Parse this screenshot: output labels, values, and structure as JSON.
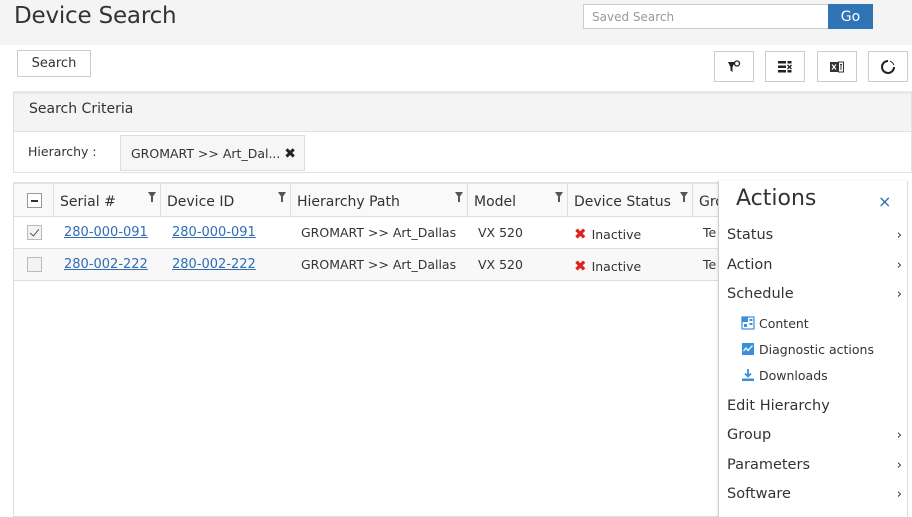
{
  "header": {
    "title": "Device Search",
    "saved_search_placeholder": "Saved Search",
    "go_label": "Go"
  },
  "toolbar": {
    "search_label": "Search",
    "tools": [
      {
        "icon": "filter-reset-icon"
      },
      {
        "icon": "column-chooser-icon"
      },
      {
        "icon": "excel-export-icon"
      },
      {
        "icon": "refresh-icon"
      }
    ]
  },
  "criteria": {
    "title": "Search Criteria",
    "hierarchy_label": "Hierarchy :",
    "hierarchy_value": "GROMART >> Art_Dal...",
    "remove_icon": "close-icon"
  },
  "grid": {
    "columns": [
      {
        "label": "Serial #"
      },
      {
        "label": "Device ID"
      },
      {
        "label": "Hierarchy Path"
      },
      {
        "label": "Model"
      },
      {
        "label": "Device Status"
      },
      {
        "label": "Gro"
      }
    ],
    "rows": [
      {
        "checked": true,
        "serial": "280-000-091",
        "device_id": "280-000-091",
        "hierarchy_path": "GROMART >> Art_Dallas",
        "model": "VX 520",
        "status": "Inactive",
        "group": "Te"
      },
      {
        "checked": false,
        "serial": "280-002-222",
        "device_id": "280-002-222",
        "hierarchy_path": "GROMART >> Art_Dallas",
        "model": "VX 520",
        "status": "Inactive",
        "group": "Te"
      }
    ]
  },
  "actions": {
    "title": "Actions",
    "close_glyph": "×",
    "chevron_glyph": "›",
    "items": [
      {
        "label": "Status",
        "has_submenu": true
      },
      {
        "label": "Action",
        "has_submenu": true
      },
      {
        "label": "Schedule",
        "has_submenu": true
      },
      {
        "label": "Edit Hierarchy",
        "has_submenu": false
      },
      {
        "label": "Group",
        "has_submenu": true
      },
      {
        "label": "Parameters",
        "has_submenu": true
      },
      {
        "label": "Software",
        "has_submenu": true
      }
    ],
    "schedule_subitems": [
      {
        "label": "Content",
        "icon": "content-icon"
      },
      {
        "label": "Diagnostic actions",
        "icon": "diagnostic-icon"
      },
      {
        "label": "Downloads",
        "icon": "download-icon"
      }
    ]
  },
  "colors": {
    "accent": "#2f75b5",
    "link": "#2f6db5",
    "status_inactive": "#e0201b",
    "header_bg": "#f4f4f4"
  }
}
